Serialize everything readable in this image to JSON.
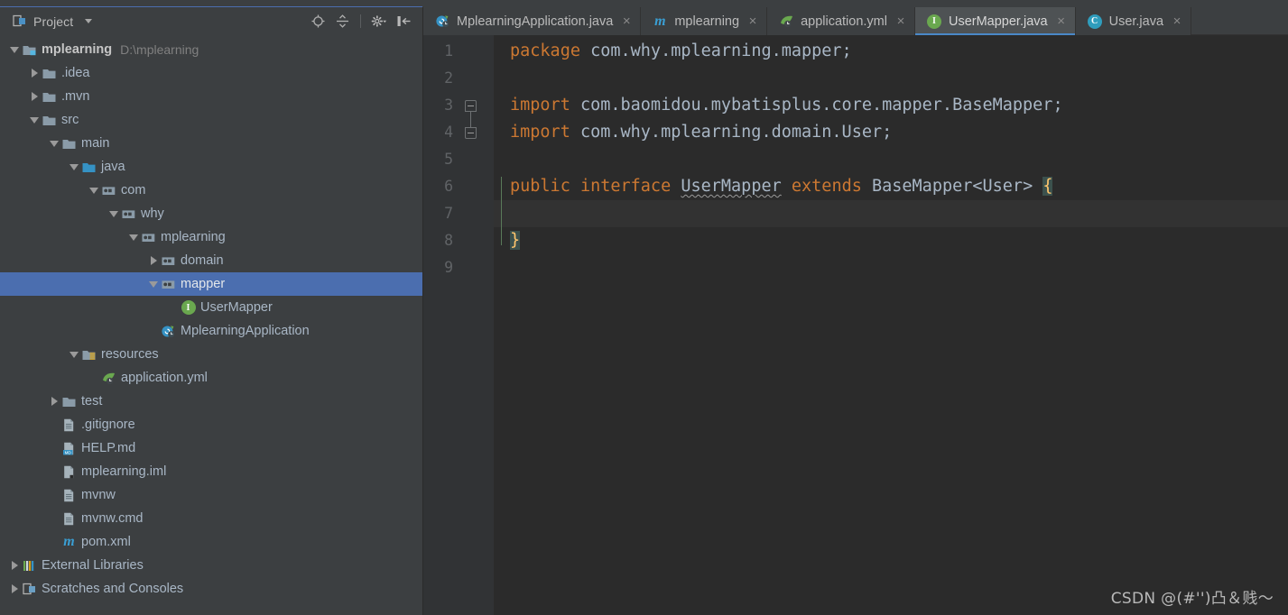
{
  "window": {
    "accent_selection": "#4b6eaf",
    "tab_underline": "#4a88c7",
    "editor_bg": "#2b2b2b",
    "panel_bg": "#3c3f41"
  },
  "sidebar": {
    "title": "Project",
    "icons": [
      {
        "name": "locate-target-icon"
      },
      {
        "name": "collapse-all-icon"
      },
      {
        "name": "gear-icon"
      },
      {
        "name": "hide-panel-icon"
      }
    ],
    "tree": [
      {
        "label": "mplearning",
        "path": "D:\\mplearning",
        "icon": "module-icon",
        "indent": 0,
        "arrow": "expanded",
        "bold": true,
        "selected": false
      },
      {
        "label": ".idea",
        "path": "",
        "icon": "folder-icon",
        "indent": 1,
        "arrow": "collapsed",
        "bold": false,
        "selected": false
      },
      {
        "label": ".mvn",
        "path": "",
        "icon": "folder-icon",
        "indent": 1,
        "arrow": "collapsed",
        "bold": false,
        "selected": false
      },
      {
        "label": "src",
        "path": "",
        "icon": "folder-icon",
        "indent": 1,
        "arrow": "expanded",
        "bold": false,
        "selected": false
      },
      {
        "label": "main",
        "path": "",
        "icon": "folder-icon",
        "indent": 2,
        "arrow": "expanded",
        "bold": false,
        "selected": false
      },
      {
        "label": "java",
        "path": "",
        "icon": "source-root-icon",
        "indent": 3,
        "arrow": "expanded",
        "bold": false,
        "selected": false
      },
      {
        "label": "com",
        "path": "",
        "icon": "package-icon",
        "indent": 4,
        "arrow": "expanded",
        "bold": false,
        "selected": false
      },
      {
        "label": "why",
        "path": "",
        "icon": "package-icon",
        "indent": 5,
        "arrow": "expanded",
        "bold": false,
        "selected": false
      },
      {
        "label": "mplearning",
        "path": "",
        "icon": "package-icon",
        "indent": 6,
        "arrow": "expanded",
        "bold": false,
        "selected": false
      },
      {
        "label": "domain",
        "path": "",
        "icon": "package-icon",
        "indent": 7,
        "arrow": "collapsed",
        "bold": false,
        "selected": false
      },
      {
        "label": "mapper",
        "path": "",
        "icon": "package-icon",
        "indent": 7,
        "arrow": "expanded",
        "bold": false,
        "selected": true
      },
      {
        "label": "UserMapper",
        "path": "",
        "icon": "interface-icon",
        "indent": 8,
        "arrow": "none",
        "bold": false,
        "selected": false
      },
      {
        "label": "MplearningApplication",
        "path": "",
        "icon": "spring-boot-class-icon",
        "indent": 7,
        "arrow": "none",
        "bold": false,
        "selected": false
      },
      {
        "label": "resources",
        "path": "",
        "icon": "resources-root-icon",
        "indent": 3,
        "arrow": "expanded",
        "bold": false,
        "selected": false
      },
      {
        "label": "application.yml",
        "path": "",
        "icon": "spring-yaml-icon",
        "indent": 4,
        "arrow": "none",
        "bold": false,
        "selected": false
      },
      {
        "label": "test",
        "path": "",
        "icon": "folder-icon",
        "indent": 2,
        "arrow": "collapsed",
        "bold": false,
        "selected": false
      },
      {
        "label": ".gitignore",
        "path": "",
        "icon": "file-icon",
        "indent": 2,
        "arrow": "none",
        "bold": false,
        "selected": false
      },
      {
        "label": "HELP.md",
        "path": "",
        "icon": "markdown-file-icon",
        "indent": 2,
        "arrow": "none",
        "bold": false,
        "selected": false
      },
      {
        "label": "mplearning.iml",
        "path": "",
        "icon": "iml-file-icon",
        "indent": 2,
        "arrow": "none",
        "bold": false,
        "selected": false
      },
      {
        "label": "mvnw",
        "path": "",
        "icon": "file-icon",
        "indent": 2,
        "arrow": "none",
        "bold": false,
        "selected": false
      },
      {
        "label": "mvnw.cmd",
        "path": "",
        "icon": "file-icon",
        "indent": 2,
        "arrow": "none",
        "bold": false,
        "selected": false
      },
      {
        "label": "pom.xml",
        "path": "",
        "icon": "maven-pom-icon",
        "indent": 2,
        "arrow": "none",
        "bold": false,
        "selected": false
      },
      {
        "label": "External Libraries",
        "path": "",
        "icon": "libraries-icon",
        "indent": 0,
        "arrow": "collapsed",
        "bold": false,
        "selected": false
      },
      {
        "label": "Scratches and Consoles",
        "path": "",
        "icon": "scratches-icon",
        "indent": 0,
        "arrow": "collapsed",
        "bold": false,
        "selected": false
      }
    ]
  },
  "tabs": [
    {
      "label": "MplearningApplication.java",
      "icon": "spring-boot-class-icon",
      "active": false,
      "close": "×"
    },
    {
      "label": "mplearning",
      "icon": "maven-module-icon",
      "active": false,
      "close": "×"
    },
    {
      "label": "application.yml",
      "icon": "spring-yaml-icon",
      "active": false,
      "close": "×"
    },
    {
      "label": "UserMapper.java",
      "icon": "interface-icon",
      "active": true,
      "close": "×"
    },
    {
      "label": "User.java",
      "icon": "class-icon",
      "active": false,
      "close": "×"
    }
  ],
  "editor": {
    "line_numbers": [
      "1",
      "2",
      "3",
      "4",
      "5",
      "6",
      "7",
      "8",
      "9"
    ],
    "current_line": 7,
    "lines": [
      {
        "n": 1,
        "segments": [
          {
            "t": "package",
            "c": "kw"
          },
          {
            "t": " com.why.mplearning.mapper;",
            "c": "txt"
          }
        ]
      },
      {
        "n": 2,
        "segments": []
      },
      {
        "n": 3,
        "segments": [
          {
            "t": "import",
            "c": "kw"
          },
          {
            "t": " com.baomidou.mybatisplus.core.mapper.BaseMapper;",
            "c": "txt"
          }
        ]
      },
      {
        "n": 4,
        "segments": [
          {
            "t": "import",
            "c": "kw"
          },
          {
            "t": " com.why.mplearning.domain.User;",
            "c": "txt"
          }
        ]
      },
      {
        "n": 5,
        "segments": []
      },
      {
        "n": 6,
        "segments": [
          {
            "t": "public interface ",
            "c": "kw"
          },
          {
            "t": "UserMapper",
            "c": "warn-ident"
          },
          {
            "t": " extends",
            "c": "kw"
          },
          {
            "t": " BaseMapper<User> ",
            "c": "txt"
          },
          {
            "t": "{",
            "c": "brace"
          }
        ]
      },
      {
        "n": 7,
        "segments": []
      },
      {
        "n": 8,
        "segments": [
          {
            "t": "}",
            "c": "brace"
          }
        ]
      },
      {
        "n": 9,
        "segments": []
      }
    ],
    "folds": [
      {
        "line": 3,
        "kind": "top"
      },
      {
        "line": 4,
        "kind": "bottom"
      }
    ]
  },
  "watermark": "CSDN @(#'')凸＆贱～"
}
